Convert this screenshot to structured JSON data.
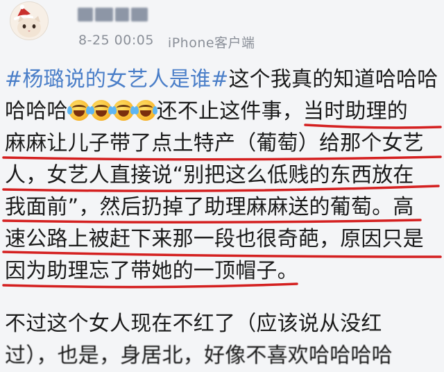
{
  "post": {
    "author": {
      "avatar": "cat-avatar-with-santa-hat"
    },
    "meta": {
      "time": "8-25 00:05",
      "source": "iPhone客户端"
    },
    "lines": {
      "l1_hashtag": "#杨璐说的女艺人是谁#",
      "l1_rest": "这个我真的知道哈哈哈",
      "l2_start": "哈哈哈",
      "l2_end": "还不止这件事，当时助理的",
      "l3": "麻麻让儿子带了点土特产（葡萄）给那个女艺",
      "l4": "人，女艺人直接说“别把这么低贱的东西放在",
      "l5": "我面前”，然后扔掉了助理麻麻送的葡萄。高",
      "l6": "速公路上被赶下来那一段也很奇葩，原因只是",
      "l7": "因为助理忘了带她的一顶帽子。",
      "l8": "不过这个女人现在不红了（应该说从没红",
      "l9": "过），也是，身居北，好像不喜欢哈哈哈哈"
    },
    "emoji": {
      "name": "laughing-tears",
      "count": 4
    },
    "underline_color": "#d42020",
    "hashtag_color": "#4a7ec8"
  }
}
